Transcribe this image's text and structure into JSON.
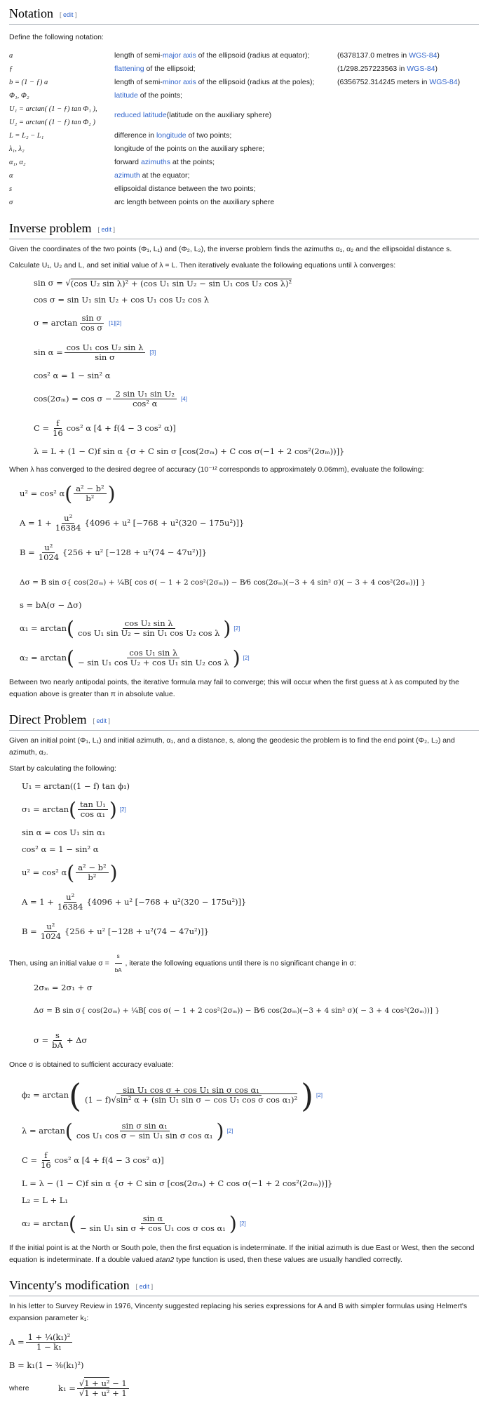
{
  "sections": {
    "notation": {
      "title": "Notation",
      "edit_label": "edit",
      "intro": "Define the following notation:",
      "rows": [
        {
          "symbol": "a",
          "desc_pre": "length of semi-",
          "desc_link": "major axis",
          "desc_post": " of the ellipsoid (radius at equator);",
          "value_pre": "(6378137.0 metres in ",
          "value_link": "WGS-84",
          "value_post": ")"
        },
        {
          "symbol": "ƒ",
          "desc_pre": "",
          "desc_link": "flattening",
          "desc_post": " of the ellipsoid;",
          "value_pre": "(1/298.257223563 in ",
          "value_link": "WGS-84",
          "value_post": ")"
        },
        {
          "symbol": "b = (1 − ƒ) a",
          "desc_pre": "length of semi-",
          "desc_link": "minor axis",
          "desc_post": " of the ellipsoid (radius at the poles);",
          "value_pre": "(6356752.314245 meters in ",
          "value_link": "WGS-84",
          "value_post": ")"
        },
        {
          "symbol": "Φ₁, Φ₂",
          "desc_pre": "",
          "desc_link": "latitude",
          "desc_post": " of the points;",
          "value_pre": "",
          "value_link": "",
          "value_post": ""
        },
        {
          "symbol": "U₁ = arctan( (1 − ƒ) tan Φ₁ ),\nU₂ = arctan( (1 − ƒ) tan Φ₂ )",
          "desc_pre": "",
          "desc_link": "reduced latitude",
          "desc_post": " (latitude on the auxiliary sphere)",
          "value_pre": "",
          "value_link": "",
          "value_post": ""
        },
        {
          "symbol": "L = L₂ − L₁",
          "desc_pre": "difference in ",
          "desc_link": "longitude",
          "desc_post": " of two points;",
          "value_pre": "",
          "value_link": "",
          "value_post": ""
        },
        {
          "symbol": "λ₁, λ₂",
          "desc_pre": "longitude of the points on the auxiliary sphere;",
          "desc_link": "",
          "desc_post": "",
          "value_pre": "",
          "value_link": "",
          "value_post": ""
        },
        {
          "symbol": "α₁, α₂",
          "desc_pre": "forward ",
          "desc_link": "azimuths",
          "desc_post": " at the points;",
          "value_pre": "",
          "value_link": "",
          "value_post": ""
        },
        {
          "symbol": "α",
          "desc_pre": "",
          "desc_link": "azimuth",
          "desc_post": " at the equator;",
          "value_pre": "",
          "value_link": "",
          "value_post": ""
        },
        {
          "symbol": "s",
          "desc_pre": "ellipsoidal distance between the two points;",
          "desc_link": "",
          "desc_post": "",
          "value_pre": "",
          "value_link": "",
          "value_post": ""
        },
        {
          "symbol": "σ",
          "desc_pre": "arc length between points on the auxiliary sphere",
          "desc_link": "",
          "desc_post": "",
          "value_pre": "",
          "value_link": "",
          "value_post": ""
        }
      ]
    },
    "inverse": {
      "title": "Inverse problem",
      "edit_label": "edit",
      "p1": "Given the coordinates of the two points (Φ₁, L₁) and (Φ₂, L₂), the inverse problem finds the azimuths α₁, α₂ and the ellipsoidal distance s.",
      "p2": "Calculate U₁, U₂ and L, and set initial value of λ = L. Then iteratively evaluate the following equations until λ converges:",
      "eq": {
        "sin_sigma_lhs": "sin σ =",
        "sin_sigma_rhs": "(cos U₂ sin λ)² + (cos U₁ sin U₂ − sin U₁ cos U₂ cos λ)²",
        "cos_sigma": "cos σ = sin U₁ sin U₂ + cos U₁ cos U₂ cos λ",
        "sigma_lhs": "σ = arctan",
        "sigma_num": "sin σ",
        "sigma_den": "cos σ",
        "sigma_ref": "[1][2]",
        "sin_alpha_lhs": "sin α =",
        "sin_alpha_num": "cos U₁ cos U₂ sin λ",
        "sin_alpha_den": "sin σ",
        "sin_alpha_ref": "[3]",
        "cos2_alpha": "cos² α = 1 − sin² α",
        "cos2sm_lhs": "cos(2σₘ) = cos σ −",
        "cos2sm_num": "2 sin U₁ sin U₂",
        "cos2sm_den": "cos² α",
        "cos2sm_ref": "[4]",
        "C_lhs": "C =",
        "C_num": "f",
        "C_den": "16",
        "C_rhs": "cos² α [4 + f(4 − 3 cos² α)]",
        "lambda": "λ = L + (1 − C)f sin α {σ + C sin σ [cos(2σₘ) + C cos σ(−1 + 2 cos²(2σₘ))]}"
      },
      "p3": "When λ has converged to the desired degree of accuracy (10⁻¹² corresponds to approximately 0.06mm), evaluate the following:",
      "eq2": {
        "u2_lhs": "u² = cos² α",
        "u2_num": "a² − b²",
        "u2_den": "b²",
        "A_lhs": "A = 1 +",
        "A_num": "u²",
        "A_den": "16384",
        "A_rhs": "{4096 + u² [−768 + u²(320 − 175u²)]}",
        "B_lhs": "B =",
        "B_num": "u²",
        "B_den": "1024",
        "B_rhs": "{256 + u² [−128 + u²(74 − 47u²)]}",
        "dsigma": "Δσ = B sin σ{ cos(2σₘ) + ¼B[ cos σ( − 1 + 2 cos²(2σₘ)) − B⁄6 cos(2σₘ)(−3 + 4 sin² σ)( − 3 + 4 cos²(2σₘ))] }",
        "s": "s = bA(σ − Δσ)",
        "a1_lhs": "α₁ = arctan",
        "a1_num": "cos U₂ sin λ",
        "a1_den": "cos U₁ sin U₂ − sin U₁ cos U₂ cos λ",
        "a1_ref": "[2]",
        "a2_lhs": "α₂ = arctan",
        "a2_num": "cos U₁ sin λ",
        "a2_den": "− sin U₁ cos U₂ + cos U₁ sin U₂ cos λ",
        "a2_ref": "[2]"
      },
      "p4": "Between two nearly antipodal points, the iterative formula may fail to converge; this will occur when the first guess at λ as computed by the equation above is greater than π in absolute value."
    },
    "direct": {
      "title": "Direct Problem",
      "edit_label": "edit",
      "p1": "Given an initial point (Φ₁, L₁) and initial azimuth, α₁, and a distance, s, along the geodesic the problem is to find the end point (Φ₂, L₂) and azimuth, α₂.",
      "p2": "Start by calculating the following:",
      "eq": {
        "U1": "U₁ = arctan((1 − f) tan ϕ₁)",
        "s1_lhs": "σ₁ = arctan",
        "s1_num": "tan U₁",
        "s1_den": "cos α₁",
        "s1_ref": "[2]",
        "sin_alpha": "sin α = cos U₁ sin α₁",
        "cos2_alpha": "cos² α = 1 − sin² α",
        "u2_lhs": "u² = cos² α",
        "u2_num": "a² − b²",
        "u2_den": "b²",
        "A_lhs": "A = 1 +",
        "A_num": "u²",
        "A_den": "16384",
        "A_rhs": "{4096 + u² [−768 + u²(320 − 175u²)]}",
        "B_lhs": "B =",
        "B_num": "u²",
        "B_den": "1024",
        "B_rhs": "{256 + u² [−128 + u²(74 − 47u²)]}"
      },
      "p3_pre": "Then, using an initial value σ = ",
      "p3_num": "s",
      "p3_den": "bA",
      "p3_post": ", iterate the following equations until there is no significant change in σ:",
      "eq2": {
        "two_sm": "2σₘ = 2σ₁ + σ",
        "dsigma": "Δσ = B sin σ{ cos(2σₘ) + ¼B[ cos σ( − 1 + 2 cos²(2σₘ)) − B⁄6 cos(2σₘ)(−3 + 4 sin² σ)( − 3 + 4 cos²(2σₘ))] }",
        "sigma_lhs": "σ =",
        "sigma_num": "s",
        "sigma_den": "bA",
        "sigma_rhs": "+ Δσ"
      },
      "p4": "Once σ is obtained to sufficient accuracy evaluate:",
      "eq3": {
        "phi2_lhs": "ϕ₂ = arctan",
        "phi2_num": "sin U₁ cos σ + cos U₁ sin σ cos α₁",
        "phi2_den_pre": "(1 − f)",
        "phi2_den_sqrt": "sin² α + (sin U₁ sin σ − cos U₁ cos σ cos α₁)²",
        "phi2_ref": "[2]",
        "lambda_lhs": "λ = arctan",
        "lambda_num": "sin σ sin α₁",
        "lambda_den": "cos U₁ cos σ − sin U₁ sin σ cos α₁",
        "lambda_ref": "[2]",
        "C_lhs": "C =",
        "C_num": "f",
        "C_den": "16",
        "C_rhs": "cos² α [4 + f(4 − 3 cos² α)]",
        "L": "L = λ − (1 − C)f sin α {σ + C sin σ [cos(2σₘ) + C cos σ(−1 + 2 cos²(2σₘ))]}",
        "L2": "L₂ = L + L₁",
        "a2_lhs": "α₂ = arctan",
        "a2_num": "sin α",
        "a2_den": "− sin U₁ sin σ + cos U₁ cos σ cos α₁",
        "a2_ref": "[2]"
      },
      "p5_pre": "If the initial point is at the North or South pole, then the first equation is indeterminate. If the initial azimuth is due East or West, then the second equation is indeterminate. If a double valued ",
      "p5_em": "atan2",
      "p5_post": " type function is used, then these values are usually handled correctly."
    },
    "vincenty": {
      "title": "Vincenty's modification",
      "edit_label": "edit",
      "p1": "In his letter to Survey Review in 1976, Vincenty suggested replacing his series expressions for A and B with simpler formulas using Helmert's expansion parameter k₁:",
      "eq": {
        "A_lhs": "A =",
        "A_num": "1 + ¼(k₁)²",
        "A_den": "1 − k₁",
        "B": "B = k₁(1 − ⅜(k₁)²)",
        "where_label": "where",
        "k1_lhs": "k₁ =",
        "k1_num_sqrt": "1 + u²",
        "k1_num_post": " − 1",
        "k1_den_sqrt": "1 + u²",
        "k1_den_post": " + 1"
      }
    }
  }
}
